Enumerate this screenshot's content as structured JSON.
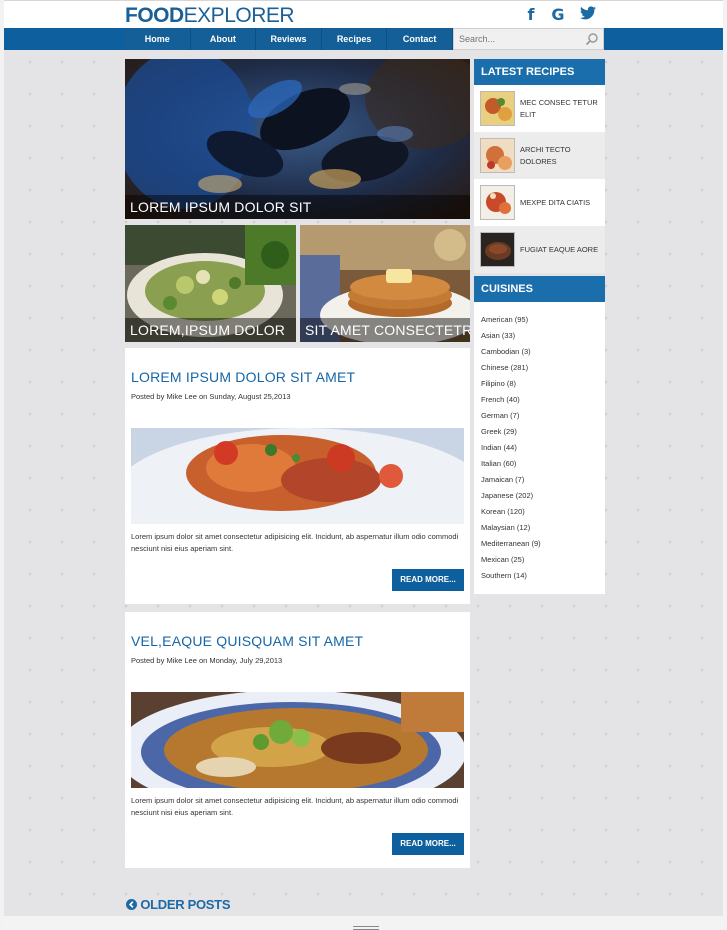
{
  "header": {
    "logo_bold": "FOOD",
    "logo_light": "EXPLORER",
    "social": {
      "facebook": "f",
      "google": "G",
      "twitter": "twitter-bird"
    }
  },
  "nav": {
    "items": [
      "Home",
      "About",
      "Reviews",
      "Recipes",
      "Contact"
    ],
    "search_placeholder": "Search..."
  },
  "featured": {
    "main_caption": "LOREM IPSUM DOLOR SIT",
    "left_caption": "LOREM,IPSUM DOLOR",
    "right_caption": "SIT AMET CONSECTETRU"
  },
  "posts": [
    {
      "title": "LOREM IPSUM DOLOR SIT AMET",
      "meta": "Posted by Mike Lee on Sunday, August 25,2013",
      "excerpt": "Lorem ipsum dolor sit amet consectetur adipisicing elit. Incidunt, ab aspernatur illum odio commodi nesciunt nisi eius aperiam sint.",
      "read_more": "READ MORE..."
    },
    {
      "title": "VEL,EAQUE QUISQUAM SIT AMET",
      "meta": "Posted by Mike Lee on Monday, July 29,2013",
      "excerpt": "Lorem ipsum dolor sit amet consectetur adipisicing elit. Incidunt, ab aspernatur illum odio commodi nesciunt nisi eius aperiam sint.",
      "read_more": "READ MORE..."
    }
  ],
  "sidebar": {
    "latest_title": "LATEST RECIPES",
    "latest": [
      "MEC CONSEC TETUR ELIT",
      "ARCHI TECTO DOLORES",
      "MEXPE DITA CIATIS",
      "FUGIAT EAQUE AORE"
    ],
    "cuisines_title": "CUISINES",
    "cuisines": [
      "American (95)",
      "Asian (33)",
      "Cambodian (3)",
      "Chinese (281)",
      "Filipino (8)",
      "French (40)",
      "German (7)",
      "Greek (29)",
      "Indian (44)",
      "Italian (60)",
      "Jamaican (7)",
      "Japanese (202)",
      "Korean (120)",
      "Malaysian (12)",
      "Mediterranean (9)",
      "Mexican (25)",
      "Southern (14)"
    ]
  },
  "footer": {
    "older_posts": "OLDER POSTS"
  },
  "colors": {
    "brand": "#0e5f9e",
    "title": "#1566a8"
  }
}
